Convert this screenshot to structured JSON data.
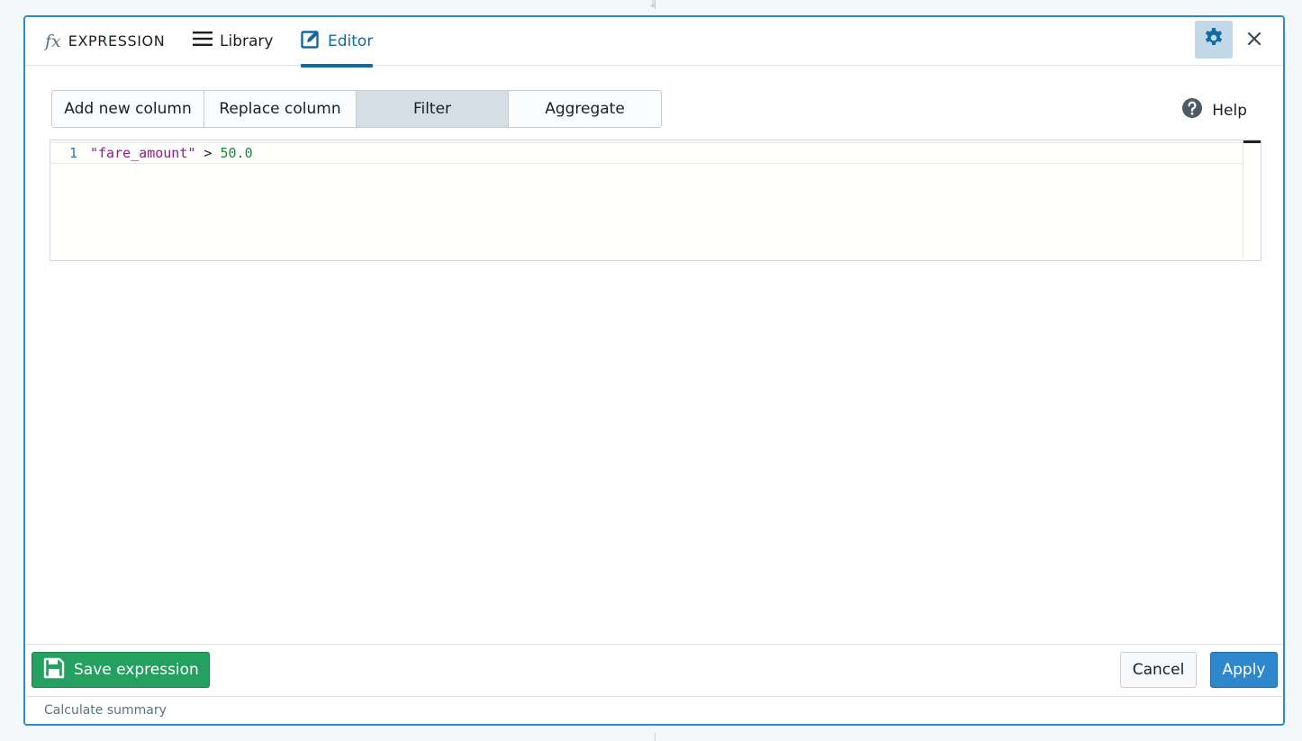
{
  "header": {
    "fx_symbol": "fx",
    "expression_label": "EXPRESSION",
    "library_label": "Library",
    "editor_label": "Editor"
  },
  "modes": {
    "add_new_column": "Add new column",
    "replace_column": "Replace column",
    "filter": "Filter",
    "aggregate": "Aggregate",
    "active": "Filter"
  },
  "help_label": "Help",
  "editor": {
    "line_number": "1",
    "token_string": "\"fare_amount\"",
    "token_operator": " > ",
    "token_number": "50.0"
  },
  "footer": {
    "save_label": "Save expression",
    "cancel_label": "Cancel",
    "apply_label": "Apply"
  },
  "summary_label": "Calculate summary",
  "colors": {
    "accent": "#2b8ad0",
    "save_green": "#24a161",
    "apply_blue": "#2e86cb",
    "active_tab": "#106ba3"
  }
}
